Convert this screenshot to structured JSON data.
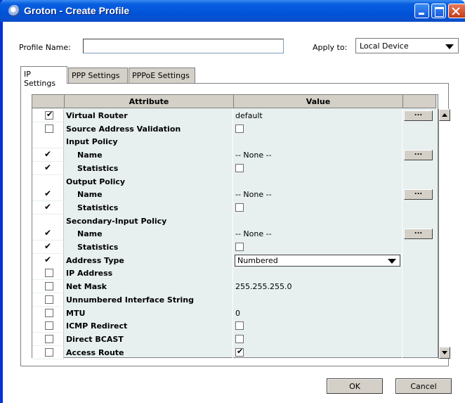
{
  "window": {
    "title": "Groton - Create Profile"
  },
  "form": {
    "profile_name_label": "Profile Name:",
    "profile_name_value": "",
    "apply_to_label": "Apply to:",
    "apply_to_value": "Local Device"
  },
  "tabs": [
    {
      "label": "IP Settings",
      "active": true
    },
    {
      "label": "PPP Settings",
      "active": false
    },
    {
      "label": "PPPoE Settings",
      "active": false
    }
  ],
  "table": {
    "headers": {
      "attribute": "Attribute",
      "value": "Value"
    },
    "rows": [
      {
        "check": "checkbox-checked",
        "attribute": "Virtual Router",
        "value": "default",
        "value_type": "text",
        "button": "...",
        "indent": false
      },
      {
        "check": "checkbox",
        "attribute": "Source Address Validation",
        "value": "",
        "value_type": "checkbox",
        "button": "",
        "indent": false
      },
      {
        "check": "none",
        "attribute": "Input Policy",
        "value": "",
        "value_type": "none",
        "button": "",
        "indent": false
      },
      {
        "check": "tick",
        "attribute": "Name",
        "value": "-- None --",
        "value_type": "text",
        "button": "...",
        "indent": true
      },
      {
        "check": "tick",
        "attribute": "Statistics",
        "value": "",
        "value_type": "checkbox",
        "button": "",
        "indent": true
      },
      {
        "check": "none",
        "attribute": "Output Policy",
        "value": "",
        "value_type": "none",
        "button": "",
        "indent": false
      },
      {
        "check": "tick",
        "attribute": "Name",
        "value": "-- None --",
        "value_type": "text",
        "button": "...",
        "indent": true
      },
      {
        "check": "tick",
        "attribute": "Statistics",
        "value": "",
        "value_type": "checkbox",
        "button": "",
        "indent": true
      },
      {
        "check": "none",
        "attribute": "Secondary-Input Policy",
        "value": "",
        "value_type": "none",
        "button": "",
        "indent": false
      },
      {
        "check": "tick",
        "attribute": "Name",
        "value": "-- None --",
        "value_type": "text",
        "button": "...",
        "indent": true
      },
      {
        "check": "tick",
        "attribute": "Statistics",
        "value": "",
        "value_type": "checkbox",
        "button": "",
        "indent": true
      },
      {
        "check": "tick",
        "attribute": "Address Type",
        "value": "Numbered",
        "value_type": "select",
        "button": "",
        "indent": false
      },
      {
        "check": "checkbox",
        "attribute": "IP Address",
        "value": "",
        "value_type": "none",
        "button": "",
        "indent": false
      },
      {
        "check": "checkbox",
        "attribute": "Net Mask",
        "value": "255.255.255.0",
        "value_type": "text",
        "button": "",
        "indent": false
      },
      {
        "check": "checkbox",
        "attribute": "Unnumbered Interface String",
        "value": "",
        "value_type": "none",
        "button": "",
        "indent": false
      },
      {
        "check": "checkbox",
        "attribute": "MTU",
        "value": "0",
        "value_type": "text",
        "button": "",
        "indent": false
      },
      {
        "check": "checkbox",
        "attribute": "ICMP Redirect",
        "value": "",
        "value_type": "checkbox",
        "button": "",
        "indent": false
      },
      {
        "check": "checkbox",
        "attribute": "Direct BCAST",
        "value": "",
        "value_type": "checkbox",
        "button": "",
        "indent": false
      },
      {
        "check": "checkbox",
        "attribute": "Access Route",
        "value": "",
        "value_type": "checkbox-checked",
        "button": "",
        "indent": false
      }
    ]
  },
  "buttons": {
    "ok": "OK",
    "cancel": "Cancel"
  },
  "icons": {
    "title": "app-globe-icon",
    "minimize": "minimize-icon",
    "maximize": "maximize-icon",
    "close": "close-icon",
    "dropdown": "chevron-down-icon",
    "scroll_up": "scroll-up-icon",
    "scroll_down": "scroll-down-icon"
  }
}
